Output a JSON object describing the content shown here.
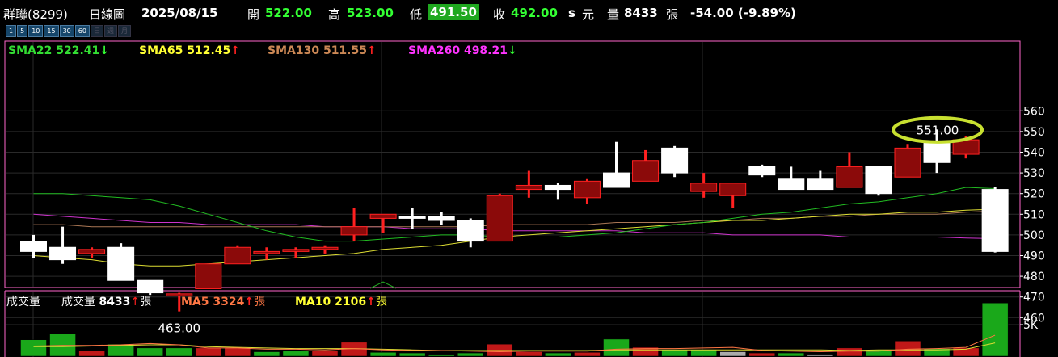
{
  "header": {
    "stock": "群聯(8299)",
    "chart_kind": "日線圖",
    "date": "2025/08/15",
    "open_label": "開",
    "open": "522.00",
    "high_label": "高",
    "high": "523.00",
    "low_label": "低",
    "low": "491.50",
    "close_label": "收",
    "close": "492.00",
    "unit_s": "s",
    "unit_yuan": "元",
    "vol_label": "量",
    "volume": "8433",
    "vol_unit": "張",
    "change": "-54.00 (-9.89%)"
  },
  "timeframes": [
    "1",
    "5",
    "10",
    "15",
    "30",
    "60",
    "日",
    "週",
    "月"
  ],
  "sma_legend": [
    {
      "label": "SMA22",
      "value": "522.41",
      "arrow": "↓",
      "color": "#33dd33",
      "arrow_class": "dn"
    },
    {
      "label": "SMA65",
      "value": "512.45",
      "arrow": "↑",
      "color": "#ffff33",
      "arrow_class": "up"
    },
    {
      "label": "SMA130",
      "value": "511.55",
      "arrow": "↑",
      "color": "#cc8855",
      "arrow_class": "up"
    },
    {
      "label": "SMA260",
      "value": "498.21",
      "arrow": "↓",
      "color": "#ff33ff",
      "arrow_class": "dn"
    }
  ],
  "volume_legend": {
    "title": "成交量",
    "vol_label": "成交量",
    "vol_value": "8433",
    "vol_arrow": "↑",
    "vol_unit": "張",
    "ma5_label": "MA5",
    "ma5_value": "3324",
    "ma5_arrow": "↑",
    "ma5_unit": "張",
    "ma10_label": "MA10",
    "ma10_value": "2106",
    "ma10_arrow": "↑",
    "ma10_unit": "張"
  },
  "annotations": {
    "low_label": "463.00",
    "high_label": "551.00"
  },
  "colors": {
    "up_body": "#8b0a0a",
    "up_border": "#ff2020",
    "down_body": "#ffffff",
    "vol_up": "#c01818",
    "vol_down": "#1aa81a",
    "vol_flat": "#aaaaaa",
    "grid": "#2a2a2a",
    "frame": "#ff66cc"
  },
  "chart_data": {
    "type": "candlestick",
    "ylim": [
      452,
      565
    ],
    "y_ticks": [
      460,
      470,
      480,
      490,
      500,
      510,
      520,
      530,
      540,
      550,
      560
    ],
    "candles": [
      {
        "o": 497,
        "h": 500,
        "l": 489,
        "c": 492
      },
      {
        "o": 494,
        "h": 504,
        "l": 486,
        "c": 488
      },
      {
        "o": 491,
        "h": 494,
        "l": 489,
        "c": 493
      },
      {
        "o": 494,
        "h": 496,
        "l": 478,
        "c": 478
      },
      {
        "o": 478,
        "h": 478,
        "l": 471,
        "c": 472
      },
      {
        "o": 471,
        "h": 472,
        "l": 463,
        "c": 471.5
      },
      {
        "o": 474,
        "h": 486,
        "l": 474,
        "c": 486
      },
      {
        "o": 486,
        "h": 495,
        "l": 486,
        "c": 494
      },
      {
        "o": 491,
        "h": 494,
        "l": 488,
        "c": 492
      },
      {
        "o": 492,
        "h": 494,
        "l": 489,
        "c": 493
      },
      {
        "o": 493,
        "h": 495,
        "l": 491,
        "c": 494
      },
      {
        "o": 500,
        "h": 513,
        "l": 497,
        "c": 504
      },
      {
        "o": 508,
        "h": 509,
        "l": 501,
        "c": 510
      },
      {
        "o": 509,
        "h": 513,
        "l": 503,
        "c": 508
      },
      {
        "o": 509,
        "h": 511,
        "l": 505,
        "c": 507
      },
      {
        "o": 507,
        "h": 508,
        "l": 494,
        "c": 497
      },
      {
        "o": 497,
        "h": 520,
        "l": 497,
        "c": 519
      },
      {
        "o": 522,
        "h": 531,
        "l": 518,
        "c": 524
      },
      {
        "o": 524,
        "h": 525,
        "l": 517,
        "c": 522
      },
      {
        "o": 518,
        "h": 527,
        "l": 515,
        "c": 526
      },
      {
        "o": 530,
        "h": 545,
        "l": 523,
        "c": 523
      },
      {
        "o": 526,
        "h": 541,
        "l": 526,
        "c": 536
      },
      {
        "o": 542,
        "h": 543,
        "l": 528,
        "c": 530
      },
      {
        "o": 521,
        "h": 530,
        "l": 518,
        "c": 525
      },
      {
        "o": 519,
        "h": 525,
        "l": 513,
        "c": 525
      },
      {
        "o": 533,
        "h": 534,
        "l": 528,
        "c": 529
      },
      {
        "o": 527,
        "h": 533,
        "l": 523,
        "c": 522
      },
      {
        "o": 527,
        "h": 531,
        "l": 522,
        "c": 522
      },
      {
        "o": 523,
        "h": 540,
        "l": 523,
        "c": 533
      },
      {
        "o": 533,
        "h": 533,
        "l": 519,
        "c": 520
      },
      {
        "o": 528,
        "h": 544,
        "l": 528,
        "c": 542
      },
      {
        "o": 545,
        "h": 551,
        "l": 530,
        "c": 535
      },
      {
        "o": 539,
        "h": 548,
        "l": 537,
        "c": 546
      },
      {
        "o": 522,
        "h": 523,
        "l": 491.5,
        "c": 492
      }
    ],
    "sma22": [
      520,
      520,
      519,
      518,
      517,
      514,
      510,
      506,
      502,
      499,
      497,
      497,
      498,
      499,
      500,
      500,
      499,
      499,
      499,
      500,
      501,
      503,
      505,
      506,
      508,
      510,
      511,
      513,
      515,
      516,
      518,
      520,
      523,
      522.41
    ],
    "sma65": [
      490,
      489,
      488,
      486,
      485,
      485,
      486,
      487,
      488,
      489,
      490,
      491,
      493,
      494,
      495,
      497,
      499,
      500,
      501,
      502,
      503,
      504,
      505,
      506,
      507,
      507,
      508,
      509,
      510,
      510,
      511,
      511,
      512,
      512.45
    ],
    "sma130": [
      505,
      505,
      504,
      504,
      504,
      504,
      504,
      504,
      504,
      504,
      504,
      504,
      504,
      504,
      504,
      504,
      505,
      505,
      505,
      505,
      506,
      506,
      506,
      507,
      507,
      508,
      508,
      509,
      509,
      510,
      510,
      510,
      511,
      511.55
    ],
    "sma260": [
      510,
      509,
      508,
      507,
      506,
      506,
      505,
      505,
      505,
      505,
      504,
      504,
      504,
      503,
      503,
      503,
      502,
      502,
      502,
      502,
      502,
      501,
      501,
      501,
      500,
      500,
      500,
      500,
      499,
      499,
      499,
      499,
      498.5,
      498.21
    ],
    "volume_ylim": [
      0,
      8800
    ],
    "volume_ticks": [
      5000
    ],
    "volume_tick_labels": [
      "5K"
    ],
    "volume": [
      2600,
      3500,
      900,
      1900,
      1300,
      1300,
      1300,
      1300,
      700,
      800,
      900,
      2200,
      600,
      500,
      300,
      500,
      1900,
      700,
      500,
      600,
      2700,
      1400,
      1000,
      1000,
      700,
      500,
      500,
      300,
      1300,
      1000,
      2400,
      1200,
      1300,
      8433
    ],
    "volume_dir": [
      "d",
      "d",
      "u",
      "d",
      "d",
      "d",
      "u",
      "u",
      "d",
      "d",
      "u",
      "u",
      "d",
      "d",
      "d",
      "d",
      "u",
      "u",
      "d",
      "u",
      "d",
      "u",
      "d",
      "d",
      "f",
      "u",
      "d",
      "f",
      "u",
      "d",
      "u",
      "d",
      "u",
      "d"
    ],
    "vol_ma5": [
      1600,
      1700,
      1700,
      1800,
      2000,
      1800,
      1300,
      1300,
      1100,
      1100,
      1000,
      1200,
      1000,
      900,
      900,
      800,
      700,
      800,
      800,
      800,
      1100,
      1200,
      1200,
      1300,
      1400,
      900,
      800,
      700,
      800,
      800,
      1100,
      1200,
      1400,
      3324
    ],
    "vol_ma10": [
      1500,
      1500,
      1600,
      1700,
      1800,
      1800,
      1500,
      1400,
      1300,
      1200,
      1200,
      1200,
      1100,
      1000,
      900,
      900,
      900,
      900,
      900,
      900,
      1000,
      1000,
      1000,
      1000,
      1000,
      1000,
      1000,
      1000,
      900,
      1000,
      1000,
      1000,
      1100,
      2106
    ]
  }
}
